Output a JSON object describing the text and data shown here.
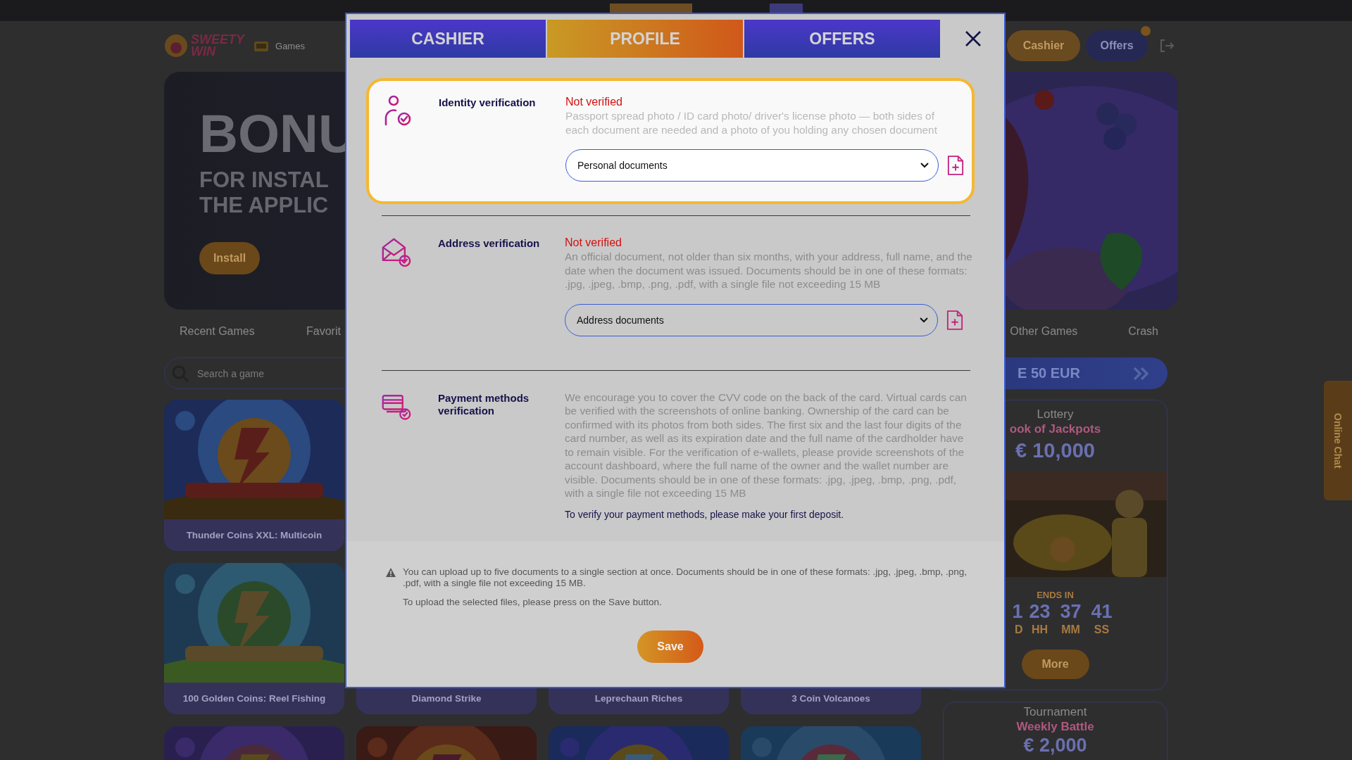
{
  "header": {
    "logo": [
      "SWEETY",
      "WIN"
    ],
    "nav_label": "Games",
    "buttons": [
      {
        "label": "Cashier",
        "kind": "cashier"
      },
      {
        "label": "Offers",
        "kind": "offers"
      }
    ]
  },
  "banner": {
    "title": "BONU",
    "subtitle": [
      "FOR INSTAL",
      "THE APPLIC"
    ],
    "button": "Install"
  },
  "category_tabs": [
    {
      "label": "Recent Games"
    },
    {
      "label": "Favorit"
    },
    {
      "label": "Other Games"
    },
    {
      "label": "Crash"
    }
  ],
  "search": {
    "placeholder": "Search a game"
  },
  "game_rows": [
    [
      {
        "title": "Thunder Coins XXL: Multicoin",
        "picture": true
      }
    ],
    [
      {
        "title": "100 Golden Coins: Reel Fishing",
        "picture": true
      },
      {
        "title": "Diamond Strike",
        "picture": false
      },
      {
        "title": "Leprechaun Riches",
        "picture": false
      },
      {
        "title": "3 Coin Volcanoes",
        "picture": false
      }
    ],
    [
      {
        "picture": true
      },
      {
        "picture": true
      },
      {
        "picture": true
      },
      {
        "picture": true
      }
    ]
  ],
  "promo": {
    "text": "E 50 EUR"
  },
  "lottery": {
    "label": "Lottery",
    "name": "ook of Jackpots",
    "prize": "€ 10,000",
    "ends_label": "ENDS IN",
    "countdown": [
      {
        "value": "1",
        "unit": "D"
      },
      {
        "value": "23",
        "unit": "HH"
      },
      {
        "value": "37",
        "unit": "MM"
      },
      {
        "value": "41",
        "unit": "SS"
      }
    ],
    "button": "More"
  },
  "tournament": {
    "label": "Tournament",
    "name": "Weekly Battle",
    "prize": "€ 2,000"
  },
  "chat_tab": "Online Chat",
  "modal": {
    "tabs": [
      {
        "label": "CASHIER",
        "selected": false
      },
      {
        "label": "PROFILE",
        "selected": true
      },
      {
        "label": "OFFERS",
        "selected": false
      }
    ],
    "sections": [
      {
        "kind": "identity",
        "highlighted": true,
        "title": "Identity verification",
        "status": "Not verified",
        "verified": false,
        "description": "Passport spread photo / ID card photo/ driver's license photo — both sides of each document are needed and a photo of you holding any chosen document",
        "select": "Personal documents"
      },
      {
        "kind": "address",
        "highlighted": false,
        "title": "Address verification",
        "status": "Not verified",
        "verified": false,
        "description": "An official document, not older than six months, with your address, full name, and the date when the document was issued. Documents should be in one of these formats: .jpg, .jpeg, .bmp, .png, .pdf, with a single file not exceeding 15 MB",
        "select": "Address documents"
      },
      {
        "kind": "payment",
        "highlighted": false,
        "title": "Payment methods verification",
        "description": "We encourage you to cover the CVV code on the back of the card. Virtual cards can be verified with the screenshots of online banking. Ownership of the card can be confirmed with its photos from both sides. The first six and the last four digits of the card number, as well as its expiration date and the full name of the cardholder have to remain visible. For the verification of e-wallets, please provide screenshots of the account dashboard, where the full name of the owner and the wallet number are visible. Documents should be in one of these formats: .jpg, .jpeg, .bmp, .png, .pdf, with a single file not exceeding 15 MB",
        "note": "To verify your payment methods, please make your first deposit."
      }
    ],
    "notice": [
      "You can upload up to five documents to a single section at once. Documents should be in one of these formats: .jpg, .jpeg, .bmp, .png, .pdf, with a single file not exceeding 15 MB.",
      "To upload the selected files, please press on the Save button."
    ],
    "save_button": "Save"
  }
}
